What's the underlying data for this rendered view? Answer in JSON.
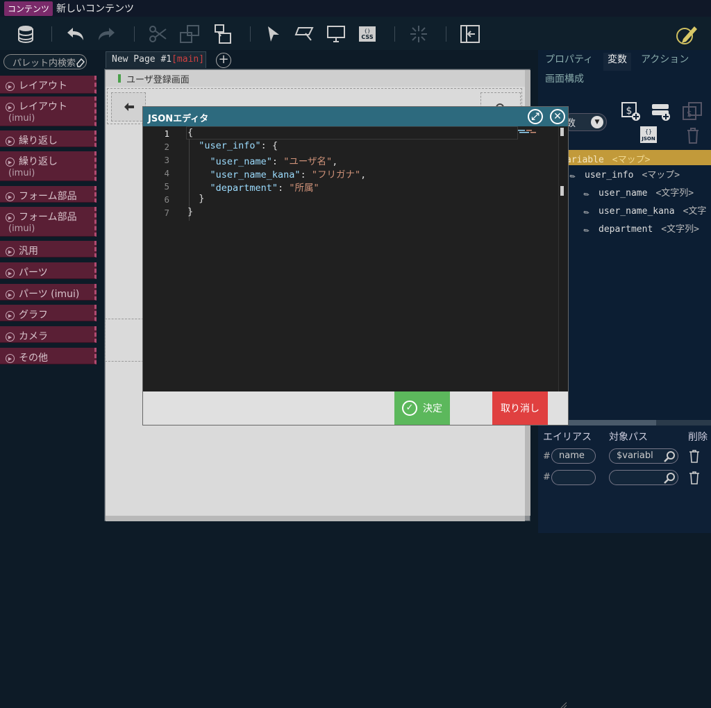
{
  "titlebar": {
    "tag": "コンテンツ",
    "title": "新しいコンテンツ"
  },
  "palette": {
    "search_placeholder": "パレット内検索",
    "items": [
      {
        "label": "レイアウト",
        "sub": ""
      },
      {
        "label": "レイアウト",
        "sub": "(imui)"
      },
      {
        "label": "繰り返し",
        "sub": ""
      },
      {
        "label": "繰り返し",
        "sub": "(imui)"
      },
      {
        "label": "フォーム部品",
        "sub": ""
      },
      {
        "label": "フォーム部品",
        "sub": "(imui)"
      },
      {
        "label": "汎用",
        "sub": ""
      },
      {
        "label": "パーツ",
        "sub": ""
      },
      {
        "label": "パーツ (imui)",
        "sub": ""
      },
      {
        "label": "グラフ",
        "sub": ""
      },
      {
        "label": "カメラ",
        "sub": ""
      },
      {
        "label": "その他",
        "sub": ""
      }
    ]
  },
  "canvas": {
    "tab_label": "New Page #1",
    "tab_suffix": "[main]",
    "screen_title": "ユーザ登録画面"
  },
  "right_panel": {
    "tabs": [
      "プロパティ",
      "変数",
      "アクション"
    ],
    "active_tab": "変数",
    "subheading": "画面構成",
    "var_select": "数",
    "tree": {
      "root": {
        "name": "ariable",
        "type": "<マップ>"
      },
      "nodes": [
        {
          "name": "user_info",
          "type": "<マップ>"
        },
        {
          "name": "user_name",
          "type": "<文字列>"
        },
        {
          "name": "user_name_kana",
          "type": "<文字"
        },
        {
          "name": "department",
          "type": "<文字列>"
        }
      ]
    },
    "alias": {
      "headers": {
        "alias": "エイリアス",
        "path": "対象パス",
        "delete": "削除"
      },
      "hash": "#",
      "rows": [
        {
          "alias": "name",
          "path": "$variabl"
        },
        {
          "alias": "",
          "path": ""
        }
      ]
    }
  },
  "modal": {
    "title": "JSONエディタ",
    "lines": [
      "1",
      "2",
      "3",
      "4",
      "5",
      "6",
      "7"
    ],
    "code": [
      {
        "indent": "",
        "key": "",
        "sep": "",
        "val": "",
        "tail": "{"
      },
      {
        "indent": "  ",
        "key": "\"user_info\"",
        "sep": ": ",
        "val": "",
        "tail": "{"
      },
      {
        "indent": "    ",
        "key": "\"user_name\"",
        "sep": ": ",
        "val": "\"ユーザ名\"",
        "tail": ","
      },
      {
        "indent": "    ",
        "key": "\"user_name_kana\"",
        "sep": ": ",
        "val": "\"フリガナ\"",
        "tail": ","
      },
      {
        "indent": "    ",
        "key": "\"department\"",
        "sep": ": ",
        "val": "\"所属\"",
        "tail": ""
      },
      {
        "indent": "  ",
        "key": "",
        "sep": "",
        "val": "",
        "tail": "}"
      },
      {
        "indent": "",
        "key": "",
        "sep": "",
        "val": "",
        "tail": "}"
      }
    ],
    "ok_label": "決定",
    "cancel_label": "取り消し"
  },
  "colors": {
    "accent": "#2d6a7e",
    "ok": "#5cb85c",
    "cancel": "#e04040",
    "palette": "#5a1f35",
    "highlight": "#c29a3a"
  }
}
